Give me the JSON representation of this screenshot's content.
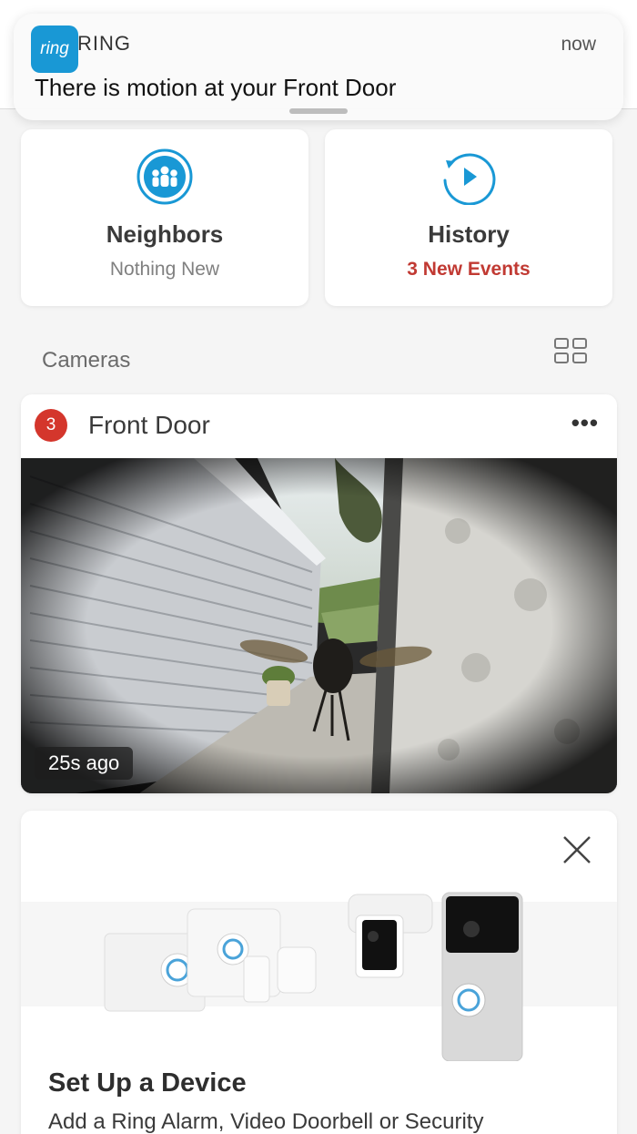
{
  "notification": {
    "app_icon_text": "ring",
    "app_name": "RING",
    "time": "now",
    "message": "There is motion at your Front Door"
  },
  "tiles": [
    {
      "title": "Neighbors",
      "subtitle": "Nothing New",
      "icon": "neighbors-icon"
    },
    {
      "title": "History",
      "subtitle": "3 New Events",
      "icon": "history-play-icon"
    }
  ],
  "colors": {
    "accent": "#1998d5",
    "alert": "#c13a33",
    "badge": "#d4362c"
  },
  "cameras": {
    "label": "Cameras",
    "items": [
      {
        "badge": "3",
        "name": "Front Door",
        "more": "•••",
        "age": "25s ago"
      }
    ]
  },
  "setup": {
    "title": "Set Up a Device",
    "description": "Add a Ring Alarm, Video Doorbell or Security"
  }
}
